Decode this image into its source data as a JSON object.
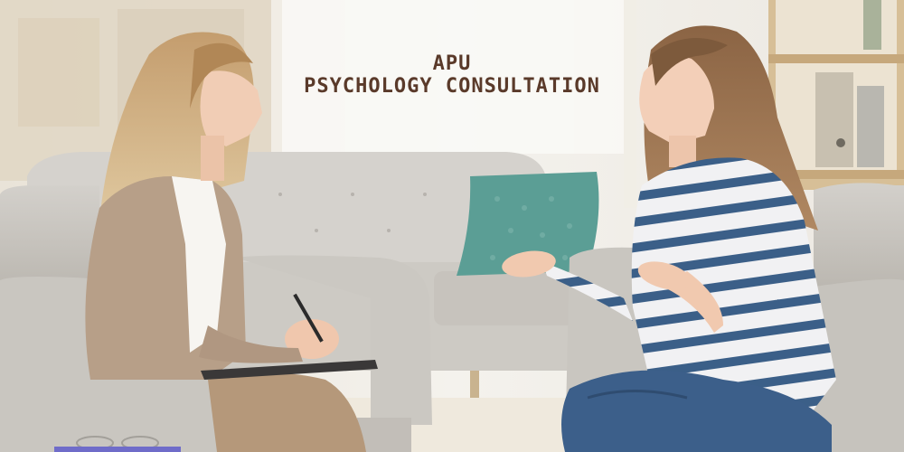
{
  "overlay": {
    "line1": "APU",
    "line2": "PSYCHOLOGY CONSULTATION"
  },
  "colors": {
    "title_text": "#5a3a2a",
    "window_light": "#f6f4ef",
    "wall": "#ebe7df",
    "sofa_grey": "#cfcbc5",
    "pillow_teal": "#5b9e95",
    "stripe_blue": "#3b5f88",
    "denim": "#3c5f8a",
    "cardigan": "#b79f88",
    "trousers": "#b5987a",
    "shelf_wood": "#d7bf97"
  }
}
